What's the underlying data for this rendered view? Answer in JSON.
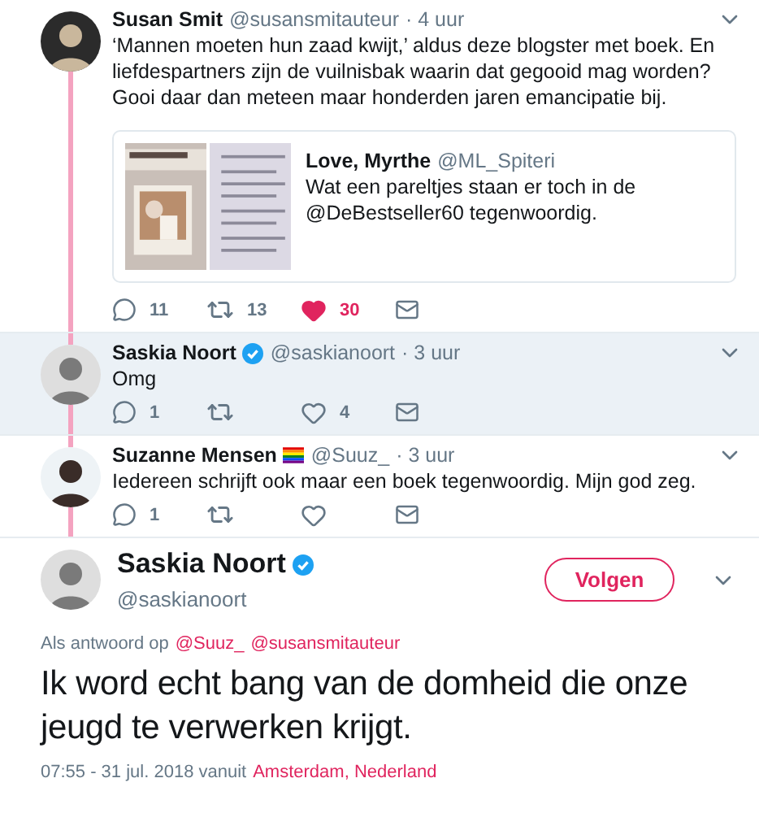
{
  "thread": [
    {
      "name": "Susan Smit",
      "verified": false,
      "flag": false,
      "handle": "@susansmitauteur",
      "time": "· 4 uur",
      "text": "‘Mannen moeten hun zaad kwijt,’ aldus deze blogster met boek. En liefdespartners zijn de vuilnisbak waarin dat gegooid mag worden? Gooi daar dan meteen maar honderden jaren emancipatie bij.",
      "highlighted": false,
      "quote": {
        "name": "Love, Myrthe",
        "handle": "@ML_Spiteri",
        "text": "Wat een pareltjes staan er toch in de @DeBestseller60 tegenwoordig."
      },
      "actions": {
        "replies": "11",
        "retweets": "13",
        "likes": "30",
        "liked": true
      }
    },
    {
      "name": "Saskia Noort",
      "verified": true,
      "flag": false,
      "handle": "@saskianoort",
      "time": "· 3 uur",
      "text": "Omg",
      "highlighted": true,
      "actions": {
        "replies": "1",
        "likes": "4",
        "liked": false
      }
    },
    {
      "name": "Suzanne Mensen",
      "verified": false,
      "flag": true,
      "handle": "@Suuz_",
      "time": "· 3 uur",
      "text": "Iedereen schrijft ook maar een boek tegenwoordig. Mijn god zeg.",
      "highlighted": false,
      "actions": {
        "replies": "1",
        "liked": false
      }
    }
  ],
  "main": {
    "name": "Saskia Noort",
    "verified": true,
    "handle": "@saskianoort",
    "follow_button": "Volgen",
    "reply_to_label": "Als antwoord op",
    "reply_to": [
      "@Suuz_",
      "@susansmitauteur"
    ],
    "text": "Ik word echt bang van de domheid die onze jeugd te verwerken krijgt.",
    "timestamp": "07:55 - 31 jul. 2018 vanuit",
    "location": "Amsterdam, Nederland"
  }
}
